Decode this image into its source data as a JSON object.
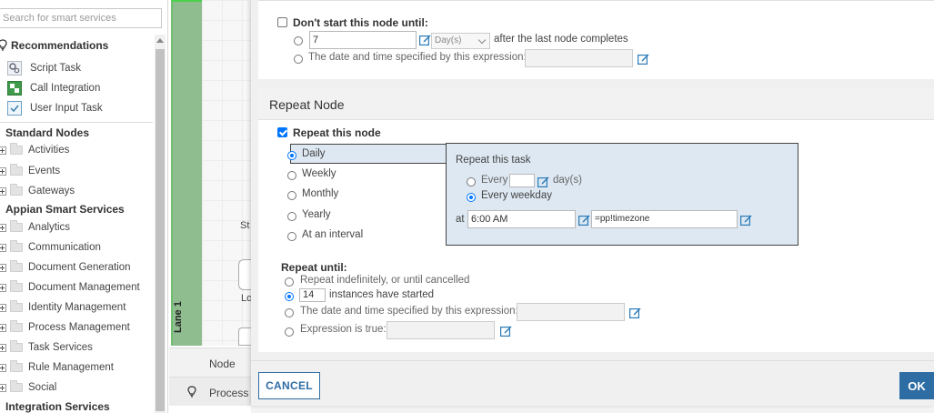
{
  "palette": {
    "search_placeholder": "Search for smart services",
    "recommendations": {
      "title": "Recommendations",
      "items": [
        "Script Task",
        "Call Integration",
        "User Input Task"
      ]
    },
    "standard_nodes": {
      "title": "Standard Nodes",
      "items": [
        "Activities",
        "Events",
        "Gateways"
      ]
    },
    "appian_smart_services": {
      "title": "Appian Smart Services",
      "items": [
        "Analytics",
        "Communication",
        "Document Generation",
        "Document Management",
        "Identity Management",
        "Process Management",
        "Task Services",
        "Rule Management",
        "Social"
      ]
    },
    "integration_services": {
      "title": "Integration Services"
    }
  },
  "canvas": {
    "lane_label": "Lane 1",
    "fragment_s": "St",
    "fragment_l": "Lo",
    "tab_node": "Node",
    "tab_process": "Process M"
  },
  "dialog": {
    "dont_start": {
      "label": "Don't start this node until:",
      "checked": false,
      "delay_value": "7",
      "unit_selected": "Day(s)",
      "after_text": "after the last node completes",
      "expression_option": "The date and time specified by this expression:"
    },
    "repeat": {
      "section_title": "Repeat Node",
      "repeat_label": "Repeat this node",
      "repeat_checked": true,
      "frequency_options": [
        "Daily",
        "Weekly",
        "Monthly",
        "Yearly",
        "At an interval"
      ],
      "frequency_selected": "Daily",
      "task_box": {
        "title": "Repeat this task",
        "every_label": "Every",
        "every_value": "",
        "days_unit": "day(s)",
        "weekday_label": "Every weekday",
        "weekday_selected": true,
        "at_label": "at",
        "time_value": "6:00 AM",
        "timezone_value": "=pp!timezone"
      },
      "until": {
        "title": "Repeat until:",
        "indefinitely": "Repeat indefinitely, or until cancelled",
        "instances_value": "14",
        "instances_text": "instances have started",
        "date_expression": "The date and time specified by this expression:",
        "expression_true": "Expression is true:",
        "selected": "instances"
      }
    },
    "buttons": {
      "cancel": "CANCEL",
      "ok": "OK"
    }
  },
  "colors": {
    "accent": "#2e6da4",
    "radio_checked": "#0075ff",
    "lane": "#8fbd8f",
    "task_box_bg": "#dde8f2",
    "edit_icon": "#2a7ab8"
  }
}
